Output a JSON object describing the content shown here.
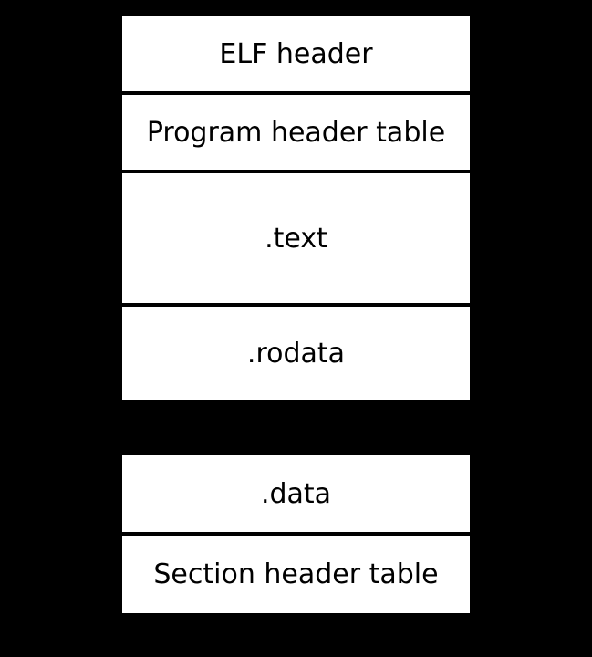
{
  "diagram": {
    "blocks": [
      {
        "label": "ELF header"
      },
      {
        "label": "Program header table"
      },
      {
        "label": ".text"
      },
      {
        "label": ".rodata"
      },
      {
        "label": ".data"
      },
      {
        "label": "Section header table"
      }
    ]
  }
}
